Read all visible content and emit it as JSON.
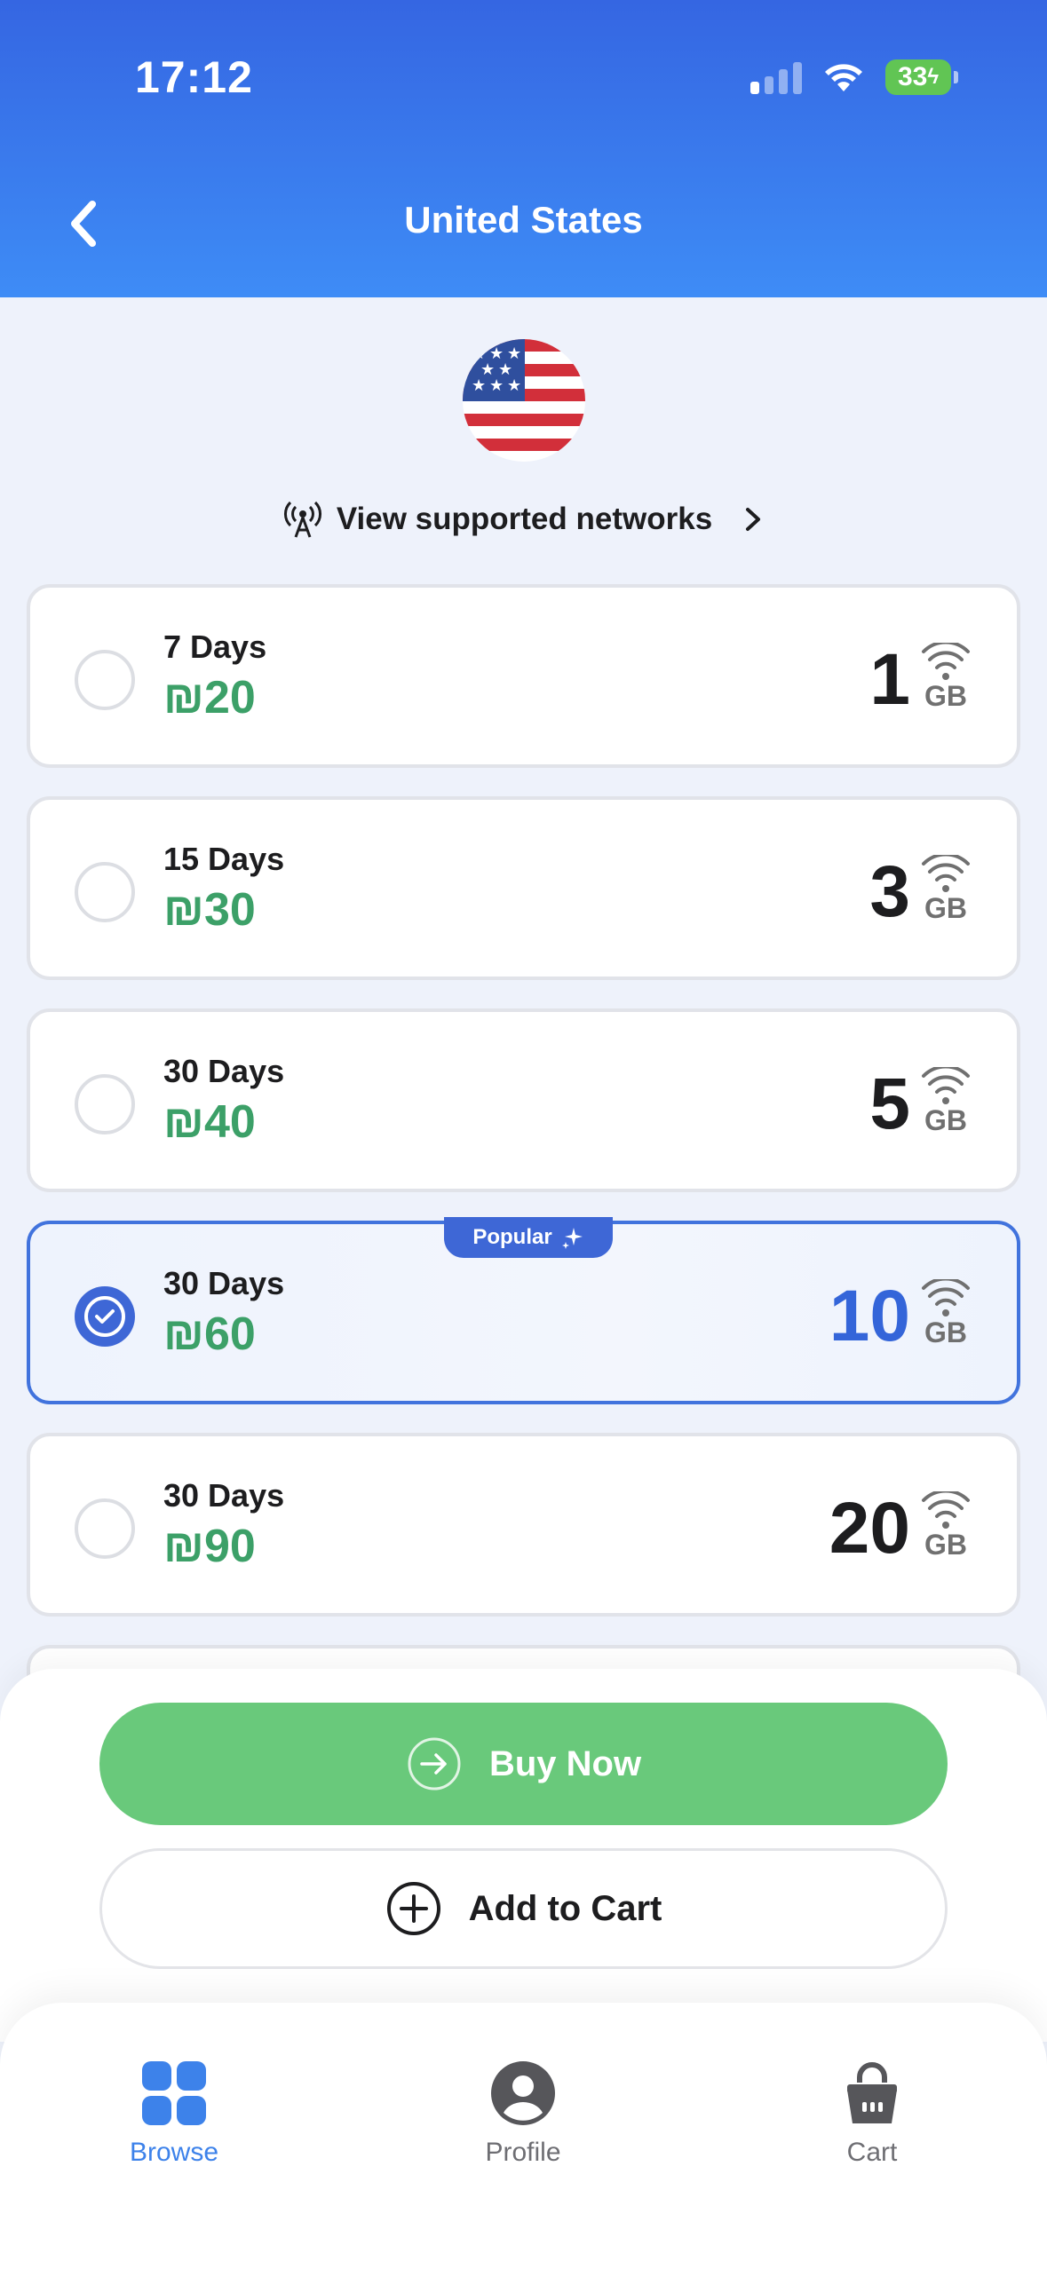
{
  "status_bar": {
    "time": "17:12",
    "battery": "33"
  },
  "header": {
    "title": "United States"
  },
  "flag": {
    "country": "United States"
  },
  "networks_link": {
    "label": "View supported networks"
  },
  "plans": [
    {
      "days": "7 Days",
      "price": "₪20",
      "data": "1",
      "unit": "GB",
      "selected": false
    },
    {
      "days": "15 Days",
      "price": "₪30",
      "data": "3",
      "unit": "GB",
      "selected": false
    },
    {
      "days": "30 Days",
      "price": "₪40",
      "data": "5",
      "unit": "GB",
      "selected": false
    },
    {
      "days": "30 Days",
      "price": "₪60",
      "data": "10",
      "unit": "GB",
      "selected": true,
      "badge": "Popular"
    },
    {
      "days": "30 Days",
      "price": "₪90",
      "data": "20",
      "unit": "GB",
      "selected": false
    }
  ],
  "actions": {
    "buy_now": "Buy Now",
    "add_to_cart": "Add to Cart"
  },
  "tabs": [
    {
      "label": "Browse",
      "active": true
    },
    {
      "label": "Profile",
      "active": false
    },
    {
      "label": "Cart",
      "active": false
    }
  ],
  "colors": {
    "header_gradient_top": "#3566e2",
    "header_gradient_bottom": "#3e8cf6",
    "price_green": "#3ca068",
    "selected_blue": "#3e67d6",
    "buy_button_green": "#69c97b",
    "tab_active": "#3d82ea"
  }
}
